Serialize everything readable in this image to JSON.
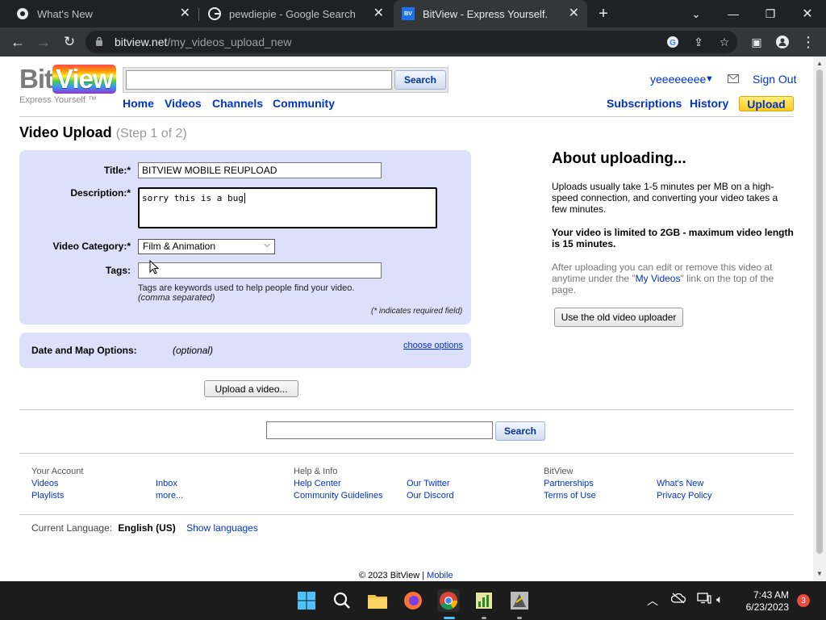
{
  "browser": {
    "tabs": [
      {
        "title": "What's New",
        "active": false
      },
      {
        "title": "pewdiepie - Google Search",
        "active": false
      },
      {
        "title": "BitView - Express Yourself.",
        "active": true
      }
    ],
    "url_host": "bitview.net",
    "url_path": "/my_videos_upload_new"
  },
  "header": {
    "logo_bit": "Bit",
    "logo_view": "View",
    "tagline": "Express Yourself ™",
    "search_button": "Search",
    "search_value": "",
    "nav": [
      "Home",
      "Videos",
      "Channels",
      "Community"
    ],
    "username": "yeeeeeeee",
    "sign_out": "Sign Out",
    "subscriptions": "Subscriptions",
    "history": "History",
    "upload": "Upload"
  },
  "upload": {
    "title": "Video Upload",
    "step": "(Step 1 of 2)",
    "labels": {
      "title": "Title:*",
      "description": "Description:*",
      "category": "Video Category:*",
      "tags": "Tags:"
    },
    "values": {
      "title": "BITVIEW MOBILE REUPLOAD",
      "description": "sorry this is a bug",
      "category": "Film & Animation",
      "tags": ""
    },
    "tags_hint": "Tags are keywords used to help people find your video.",
    "tags_hint2": "(comma separated)",
    "required_note": "(* indicates required field)",
    "date_label": "Date and Map Options:",
    "date_optional": "(optional)",
    "choose_options": "choose options",
    "upload_button": "Upload a video..."
  },
  "about": {
    "title": "About uploading...",
    "p1": "Uploads usually take 1-5 minutes per MB on a high-speed connection, and converting your video takes a few minutes.",
    "p2": "Your video is limited to 2GB - maximum video length is 15 minutes.",
    "p3_a": "After uploading you can edit or remove this video at anytime under the \"",
    "p3_link": "My Videos",
    "p3_b": "\" link on the top of the page.",
    "old_uploader": "Use the old video uploader"
  },
  "footer": {
    "search_button": "Search",
    "your_account": "Your Account",
    "videos": "Videos",
    "playlists": "Playlists",
    "inbox": "Inbox",
    "more": "more...",
    "help_info": "Help & Info",
    "help_center": "Help Center",
    "community_guidelines": "Community Guidelines",
    "our_twitter": "Our Twitter",
    "our_discord": "Our Discord",
    "bitview": "BitView",
    "partnerships": "Partnerships",
    "terms": "Terms of Use",
    "whats_new": "What's New",
    "privacy": "Privacy Policy",
    "current_language_label": "Current Language:",
    "current_language": "English (US)",
    "show_languages": "Show languages",
    "copyright": "© 2023 BitView |",
    "mobile": "Mobile"
  },
  "taskbar": {
    "time": "7:43 AM",
    "date": "6/23/2023",
    "notifications": "3"
  }
}
